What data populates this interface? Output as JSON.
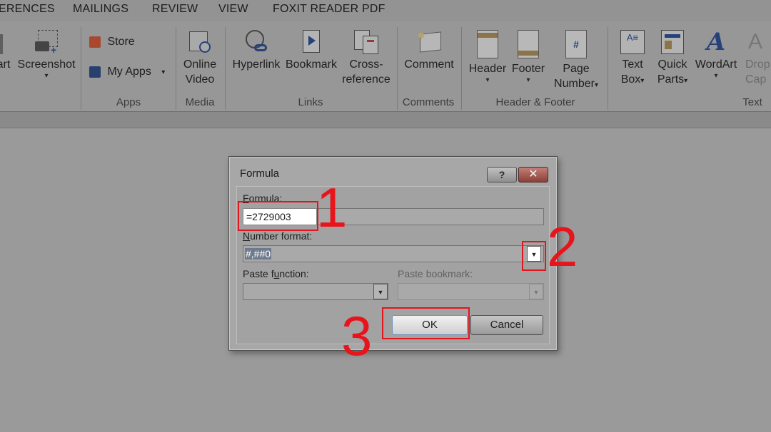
{
  "tabs": [
    "ERENCES",
    "MAILINGS",
    "REVIEW",
    "VIEW",
    "FOXIT READER PDF"
  ],
  "ribbon": {
    "art_partial": "art",
    "screenshot": "Screenshot",
    "store": "Store",
    "my_apps": "My Apps",
    "group_apps": "Apps",
    "online": "Online",
    "video": "Video",
    "group_media": "Media",
    "hyperlink": "Hyperlink",
    "bookmark": "Bookmark",
    "cross": "Cross-",
    "reference": "reference",
    "group_links": "Links",
    "comment": "Comment",
    "group_comments": "Comments",
    "header": "Header",
    "footer": "Footer",
    "page": "Page",
    "number": "Number",
    "group_header_footer": "Header & Footer",
    "text": "Text",
    "box": "Box",
    "quick": "Quick",
    "parts": "Parts",
    "wordart": "WordArt",
    "drop": "Drop",
    "cap": "Cap",
    "group_text": "Text",
    "dropdown_glyph": "▾"
  },
  "dialog": {
    "title": "Formula",
    "help": "?",
    "close": "✕",
    "formula_label_first": "F",
    "formula_label_rest": "ormula:",
    "formula_value": "=2729003",
    "number_format_label_first": "N",
    "number_format_label_rest": "umber format:",
    "number_format_value": "#,##0",
    "paste_function_label_a": "Paste f",
    "paste_function_label_u": "u",
    "paste_function_label_b": "nction:",
    "paste_bookmark_label": "Paste bookmark:",
    "ok": "OK",
    "cancel": "Cancel",
    "arrow_glyph": "▼"
  },
  "annotations": [
    "1",
    "2",
    "3"
  ],
  "colors": {
    "highlight_red": "#e0161e"
  }
}
